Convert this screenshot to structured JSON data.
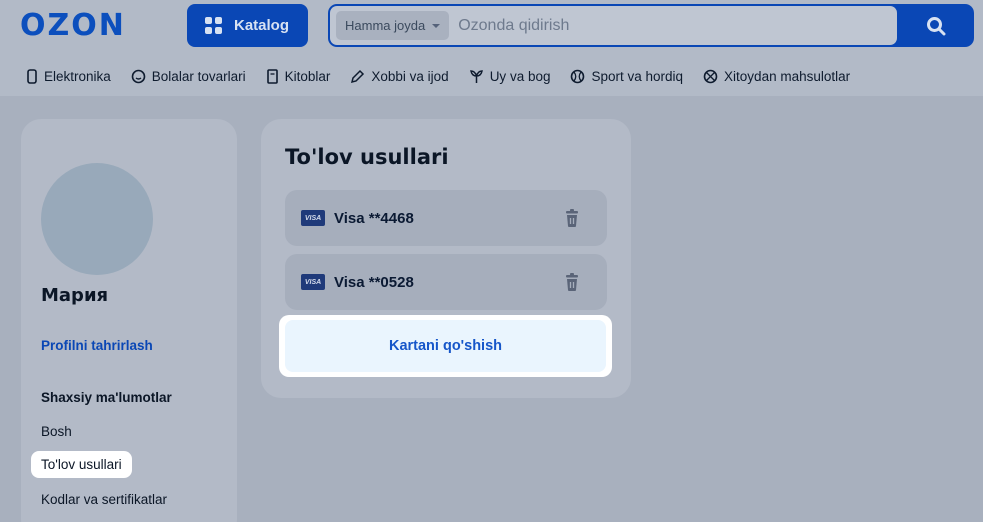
{
  "header": {
    "logo": "OZON",
    "catalog_label": "Katalog",
    "search": {
      "scope": "Hamma joyda",
      "placeholder": "Ozonda qidirish"
    },
    "categories": [
      {
        "label": "Elektronika",
        "icon": "phone-icon"
      },
      {
        "label": "Bolalar tovarlari",
        "icon": "baby-icon"
      },
      {
        "label": "Kitoblar",
        "icon": "book-icon"
      },
      {
        "label": "Xobbi va ijod",
        "icon": "pencil-icon"
      },
      {
        "label": "Uy va bog",
        "icon": "plant-icon"
      },
      {
        "label": "Sport va hordiq",
        "icon": "ball-icon"
      },
      {
        "label": "Xitoydan mahsulotlar",
        "icon": "globe-icon"
      }
    ]
  },
  "sidebar": {
    "user_name": "Мария",
    "edit_profile": "Profilni tahrirlash",
    "section_title": "Shaxsiy ma'lumotlar",
    "items": [
      {
        "label": "Bosh"
      },
      {
        "label": "To'lov usullari",
        "active": true
      },
      {
        "label": "Kodlar va sertifikatlar"
      }
    ]
  },
  "main": {
    "title": "To'lov usullari",
    "cards": [
      {
        "brand": "VISA",
        "label": "Visa **4468"
      },
      {
        "brand": "VISA",
        "label": "Visa **0528"
      }
    ],
    "add_card_label": "Kartani qo'shish"
  },
  "colors": {
    "brand_blue": "#0a47b5",
    "accent_blue": "#1656c9",
    "overlay": "#a8b0be",
    "highlight": "#ffffff"
  }
}
